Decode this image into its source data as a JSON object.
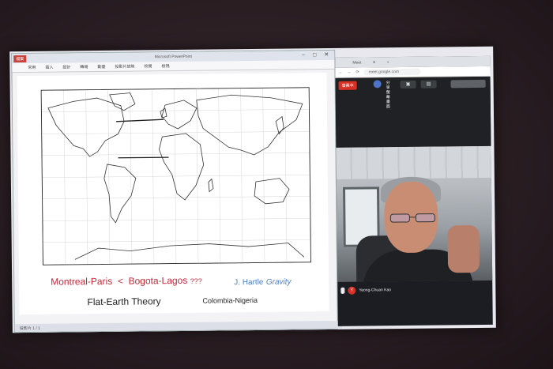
{
  "slide": {
    "line1_left": "Montreal-Paris",
    "line1_op": "<",
    "line1_right": "Bogota-Lagos",
    "line1_q": "???",
    "line1_ref": "J. Hartle",
    "line1_ref_word": "Gravity",
    "line2_left": "Flat-Earth Theory",
    "line2_right": "Colombia-Nigeria"
  },
  "ppt": {
    "title": "Microsoft PowerPoint",
    "file_tab": "檔案",
    "ribbon": [
      "常用",
      "插入",
      "設計",
      "轉場",
      "動畫",
      "投影片放映",
      "校閱",
      "檢視"
    ],
    "status_page": "投影片 1 / 1"
  },
  "meet": {
    "tab_label": "Meet",
    "url": "meet.google.com",
    "share_badge": "螢幕中",
    "share_vertical": "分享螢幕畫面",
    "participant": "Yeong-Chuan Kao",
    "avatar_letter": "Y"
  }
}
